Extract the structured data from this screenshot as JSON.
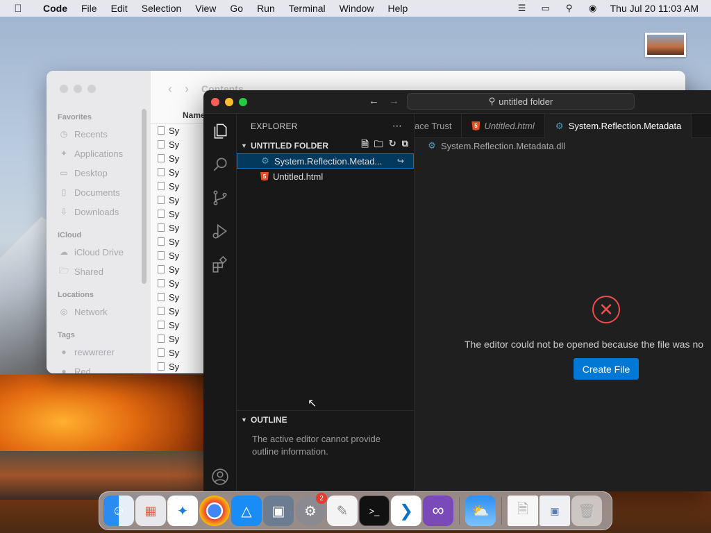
{
  "menubar": {
    "app": "Code",
    "items": [
      "File",
      "Edit",
      "Selection",
      "View",
      "Go",
      "Run",
      "Terminal",
      "Window",
      "Help"
    ],
    "clock": "Thu Jul 20  11:03 AM"
  },
  "finder": {
    "title": "Contents",
    "column_name": "Name",
    "favorites_label": "Favorites",
    "favorites": [
      "Recents",
      "Applications",
      "Desktop",
      "Documents",
      "Downloads"
    ],
    "icloud_label": "iCloud",
    "icloud": [
      "iCloud Drive",
      "Shared"
    ],
    "locations_label": "Locations",
    "locations": [
      "Network"
    ],
    "tags_label": "Tags",
    "tags": [
      "rewwrerer",
      "Red"
    ],
    "row_prefix": "Sy"
  },
  "vscode": {
    "search": "untitled folder",
    "explorer_label": "EXPLORER",
    "folder": "UNTITLED FOLDER",
    "files": [
      {
        "name": "System.Reflection.Metad...",
        "type": "dll"
      },
      {
        "name": "Untitled.html",
        "type": "html"
      }
    ],
    "outline_label": "OUTLINE",
    "outline_msg": "The active editor cannot provide outline information.",
    "tabs": [
      {
        "label": "ace Trust",
        "type": "none"
      },
      {
        "label": "Untitled.html",
        "type": "html"
      },
      {
        "label": "System.Reflection.Metadata",
        "type": "dll"
      }
    ],
    "breadcrumb": "System.Reflection.Metadata.dll",
    "error_msg": "The editor could not be opened because the file was no",
    "create_button": "Create File"
  },
  "dock": {
    "apps": [
      "Finder",
      "Launchpad",
      "Safari",
      "Chrome",
      "App Store",
      "Preview",
      "System Settings",
      "TextEdit",
      "Terminal",
      "VS Code",
      "Visual Studio",
      "Weather",
      "Document",
      "Image File",
      "Trash"
    ],
    "settings_badge": "2"
  }
}
